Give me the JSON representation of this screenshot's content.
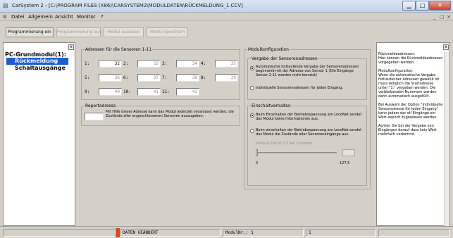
{
  "window": {
    "title": "CarSystem 2 - [C:\\PROGRAM FILES (X86)\\CARSYSTEM2\\MODULDATEN\\RÜCKMELDUNG_1.CCV]",
    "min_glyph": "▁",
    "max_glyph": "□",
    "close_glyph": "✕"
  },
  "menubar": {
    "items": [
      "Datei",
      "Allgemein",
      "Ansicht",
      "Monitor",
      "?"
    ],
    "mdi_controls": [
      "_",
      "□",
      "×"
    ]
  },
  "toolbar": {
    "buttons": [
      {
        "label": "Programmierung ein",
        "enabled": true
      },
      {
        "label": "Programmierung aus",
        "enabled": false
      },
      {
        "label": "Modul auslesen",
        "enabled": false
      },
      {
        "label": "Modul speichern",
        "enabled": false
      }
    ]
  },
  "tree": {
    "close_glyph": "x",
    "root": "PC-Grundmodul(1):",
    "selected": "Rückmeldung",
    "items": [
      "Schaltausgänge"
    ]
  },
  "sensors": {
    "legend": "Adressen für die Sensoren 1-11",
    "entries": [
      {
        "label": "1:",
        "value": "32",
        "grey": false
      },
      {
        "label": "2:",
        "value": "33",
        "grey": true
      },
      {
        "label": "3:",
        "value": "34",
        "grey": true
      },
      {
        "label": "4:",
        "value": "35",
        "grey": true
      },
      {
        "label": "5:",
        "value": "36",
        "grey": true
      },
      {
        "label": "6:",
        "value": "37",
        "grey": true
      },
      {
        "label": "7:",
        "value": "38",
        "grey": true
      },
      {
        "label": "8:",
        "value": "39",
        "grey": true
      },
      {
        "label": "9:",
        "value": "40",
        "grey": true
      },
      {
        "label": "10:",
        "value": "41",
        "grey": true
      },
      {
        "label": "11:",
        "value": "42",
        "grey": true
      }
    ]
  },
  "report": {
    "legend": "Reportadresse",
    "value": "",
    "description": "Mit Hilfe dieser Adresse kann das Modul jederzeit veranlasst werden, die Zustände aller angeschlossenen Sensoren auszugeben."
  },
  "modulkonfig": {
    "legend": "Modulkonfiguration",
    "sensor_group": {
      "legend": "Vergabe der Sensorenadressen",
      "options": [
        {
          "text": "Automatische fortlaufende Vergabe der Sensorenadressen beginnend mit der Adresse von Sensor 1 (Die Eingänge Sensor 2-11 werden nicht benutzt)",
          "selected": true
        },
        {
          "text": "Individuelle Sensorenadressen für jeden Eingang.",
          "selected": false
        }
      ]
    },
    "einschalt": {
      "legend": "Einschaltverhalten",
      "options": [
        {
          "text": "Beim Einschalten der Betriebsspannung am LocoNet sendet das Modul keine Informationen aus.",
          "selected": true
        },
        {
          "text": "Beim einschalten der Betriebsspannung am LocoNet sendet das Modul die Zustände aller Sensoreneingänge aus.",
          "selected": false
        }
      ],
      "startup_label": "Startup-Zeit in 0,5 sek Schritten",
      "slider_value": 0.0,
      "slider_min": "0",
      "slider_max": "127,5"
    }
  },
  "help": {
    "close_glyph": "x",
    "text": "Rückmeldeadressen:\nHier können die Rückmeldeadressen vorgegeben werden.\n\nModulkonfiguration:\nWenn die automatische Vergabe fortlaufender Adressen gewählt ist muss lediglich die Startadresse unter \"1:\" vergeben werden. Die verbleibenden Nummern werden dann automatisch ausgefüllt.\n\nBei Auswahl der Option \"Individuelle Sensoradresse für jeden Eingang\" kann jedem der elf Eingänge ein Wert explizit zugewiesen werden.\n\nAchten Sie bei der Vergabe von Eingängen darauf dass kein Wert mehrfach vorkommt."
  },
  "status": {
    "message": "DATEN GEÄNDERT",
    "modulnr": "ModulNr.: 1",
    "value": "1"
  },
  "colors": {
    "selection": "#1a5fd2",
    "status_indicator": "#e0451f"
  }
}
